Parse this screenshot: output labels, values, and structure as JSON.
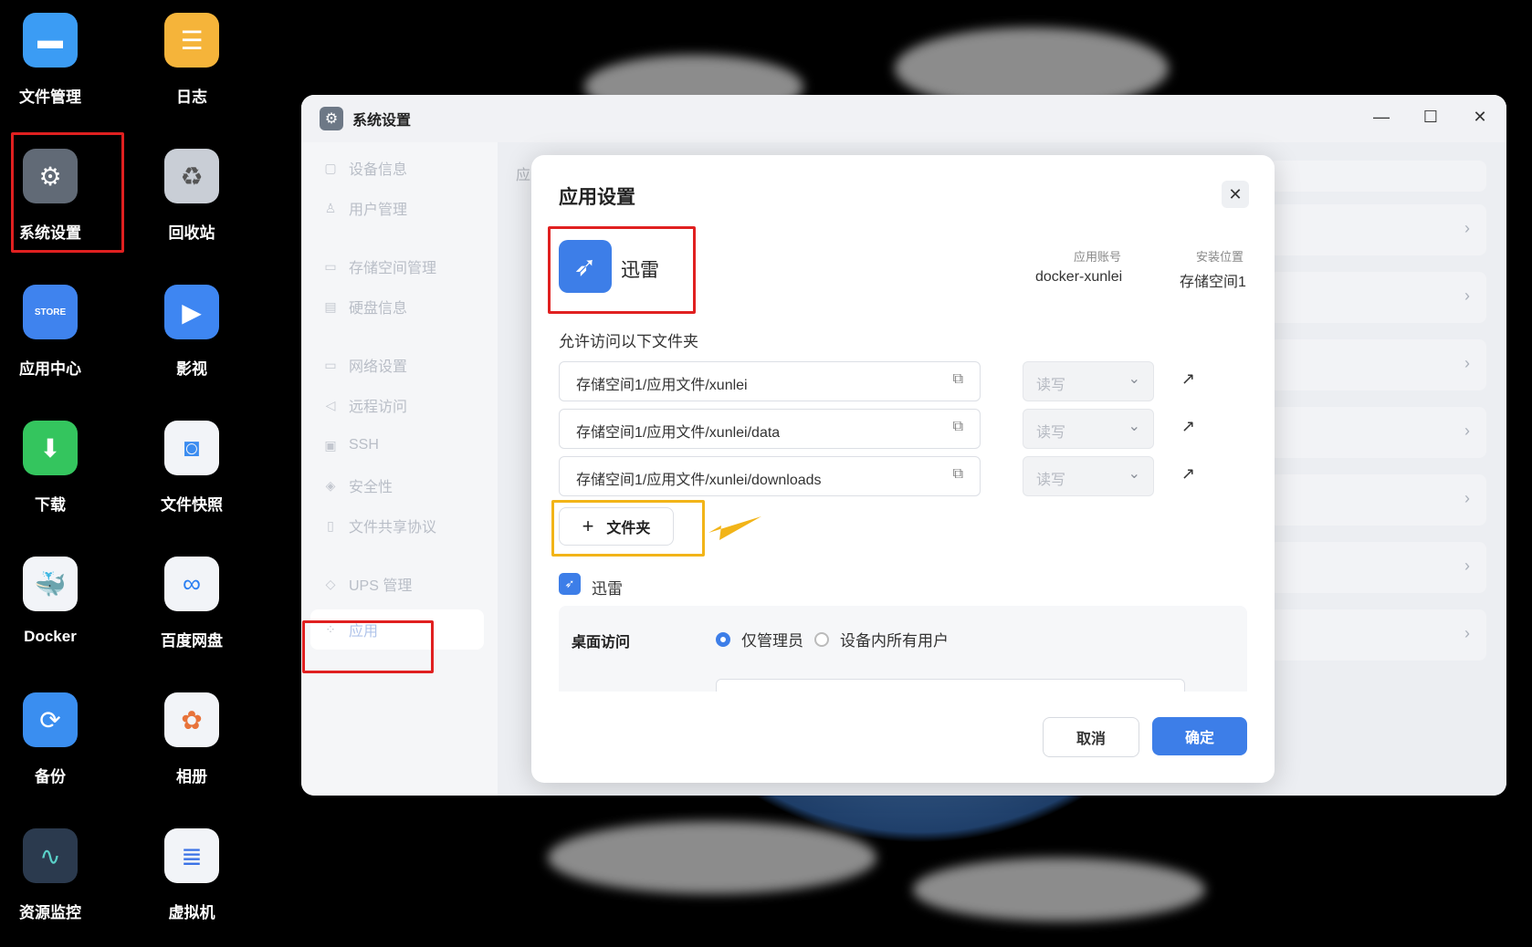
{
  "desktop": {
    "icons": [
      {
        "label": "文件管理",
        "icon": "folder-icon",
        "color": "#3b9cf4"
      },
      {
        "label": "日志",
        "icon": "log-icon",
        "color": "#f5b43a"
      },
      {
        "label": "系统设置",
        "icon": "gear-icon",
        "color": "#616a76"
      },
      {
        "label": "回收站",
        "icon": "recycle-icon",
        "color": "#c9ced6"
      },
      {
        "label": "应用中心",
        "icon": "store-icon",
        "color": "#3f83ee"
      },
      {
        "label": "影视",
        "icon": "video-icon",
        "color": "#3e86f2"
      },
      {
        "label": "下载",
        "icon": "download-icon",
        "color": "#34c55e"
      },
      {
        "label": "文件快照",
        "icon": "snapshot-icon",
        "color": "#f2f4f8"
      },
      {
        "label": "Docker",
        "icon": "docker-icon",
        "color": "#f2f4f8"
      },
      {
        "label": "百度网盘",
        "icon": "baidu-cloud-icon",
        "color": "#f2f4f8"
      },
      {
        "label": "备份",
        "icon": "backup-icon",
        "color": "#3a8ef0"
      },
      {
        "label": "相册",
        "icon": "photos-icon",
        "color": "#f2f4f8"
      },
      {
        "label": "资源监控",
        "icon": "monitor-icon",
        "color": "#2b3a4e"
      },
      {
        "label": "虚拟机",
        "icon": "vm-icon",
        "color": "#f2f4f8"
      }
    ],
    "store_text": "STORE"
  },
  "window": {
    "title": "系统设置",
    "controls": {
      "minimize": "—",
      "maximize": "☐",
      "close": "✕"
    }
  },
  "sidebar": {
    "items": [
      {
        "label": "设备信息",
        "icon": "device-icon"
      },
      {
        "label": "用户管理",
        "icon": "user-icon"
      },
      {
        "label": "存储空间管理",
        "icon": "storage-icon"
      },
      {
        "label": "硬盘信息",
        "icon": "disk-icon"
      },
      {
        "label": "网络设置",
        "icon": "network-icon"
      },
      {
        "label": "远程访问",
        "icon": "remote-icon"
      },
      {
        "label": "SSH",
        "icon": "ssh-icon"
      },
      {
        "label": "安全性",
        "icon": "shield-icon"
      },
      {
        "label": "文件共享协议",
        "icon": "share-icon"
      },
      {
        "label": "UPS 管理",
        "icon": "ups-icon"
      },
      {
        "label": "应用",
        "icon": "apps-icon"
      }
    ]
  },
  "content_stub": {
    "partial_text": "应"
  },
  "dialog": {
    "title": "应用设置",
    "close": "✕",
    "app": {
      "name": "迅雷"
    },
    "account_label": "应用账号",
    "account_value": "docker-xunlei",
    "location_label": "安装位置",
    "location_value": "存储空间1",
    "allowed_folders_label": "允许访问以下文件夹",
    "folders": [
      {
        "path": "存储空间1/应用文件/xunlei",
        "permission": "读写"
      },
      {
        "path": "存储空间1/应用文件/xunlei/data",
        "permission": "读写"
      },
      {
        "path": "存储空间1/应用文件/xunlei/downloads",
        "permission": "读写"
      }
    ],
    "add_folder_label": "文件夹",
    "sub_app_name": "迅雷",
    "desktop_access_label": "桌面访问",
    "options": [
      "仅管理员",
      "设备内所有用户"
    ],
    "selected_option": "仅管理员",
    "cancel_label": "取消",
    "ok_label": "确定"
  },
  "colors": {
    "accent": "#3d7ee8",
    "highlight_red": "#e02020",
    "highlight_yellow": "#f2b418"
  }
}
